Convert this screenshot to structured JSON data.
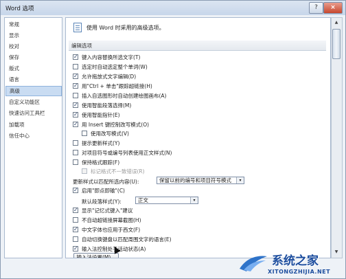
{
  "window": {
    "title": "Word 选项",
    "help_icon": "?",
    "close_icon": "×"
  },
  "sidebar": {
    "items": [
      {
        "label": "常规"
      },
      {
        "label": "显示"
      },
      {
        "label": "校对"
      },
      {
        "label": "保存"
      },
      {
        "label": "版式"
      },
      {
        "label": "语言"
      },
      {
        "label": "高级",
        "selected": true
      },
      {
        "label": "自定义功能区"
      },
      {
        "label": "快速访问工具栏"
      },
      {
        "label": "加载项"
      },
      {
        "label": "信任中心"
      }
    ]
  },
  "panel": {
    "intro": "使用 Word 时采用的高级选项。",
    "section_title": "编辑选项",
    "options": [
      {
        "label": "键入内容替换所选文字(T)",
        "checked": true
      },
      {
        "label": "选定时自动选定整个单词(W)",
        "checked": false
      },
      {
        "label": "允许拖放式文字编辑(D)",
        "checked": true
      },
      {
        "label": "用\"Ctrl + 单击\"跟踪超链接(H)",
        "checked": true
      },
      {
        "label": "插入自选图形时自动创建绘图画布(A)",
        "checked": false
      },
      {
        "label": "使用智能段落选择(M)",
        "checked": true
      },
      {
        "label": "使用智能指针(E)",
        "checked": true
      },
      {
        "label": "用 Insert 键控制改写模式(O)",
        "checked": true
      },
      {
        "label": "使用改写模式(V)",
        "checked": false
      },
      {
        "label": "提示更新样式(Y)",
        "checked": false
      },
      {
        "label": "对项目符号或编号列表使用正文样式(N)",
        "checked": false
      },
      {
        "label": "保持格式跟踪(F)",
        "checked": false
      },
      {
        "label": "标记格式不一致错误(R)",
        "checked": false,
        "disabled": true
      }
    ],
    "style_update": {
      "label": "更新样式以匹配所选内容(U):",
      "value": "保留以前的编号和项目符号模式"
    },
    "options2": [
      {
        "label": "启用\"即点即输\"(C)",
        "checked": true
      }
    ],
    "default_paragraph_style": {
      "label": "默认段落样式(Y):",
      "value": "正文"
    },
    "options3": [
      {
        "label": "显示\"记忆式键入\"建议",
        "checked": true
      },
      {
        "label": "不自动超链接屏幕截图(H)",
        "checked": false
      },
      {
        "label": "中文字体也应用于西文(F)",
        "checked": true
      },
      {
        "label": "自动切换键盘以匹配周围文字的语言(E)",
        "checked": false
      },
      {
        "label": "输入法控制处于活动状态(A)",
        "checked": true
      }
    ],
    "ime_settings_button": "输入法设置(M)..."
  },
  "watermark": {
    "text": "系统之家",
    "url": "XITONGZHIJIA.NET"
  },
  "colors": {
    "accent": "#c9dcf2",
    "check": "#243b63",
    "close": "#c7472e",
    "watermark": "#1c4d9e"
  },
  "icons": {
    "checkmark": "✓",
    "dropdown": "▾",
    "scroll_up": "▲",
    "scroll_down": "▼"
  }
}
